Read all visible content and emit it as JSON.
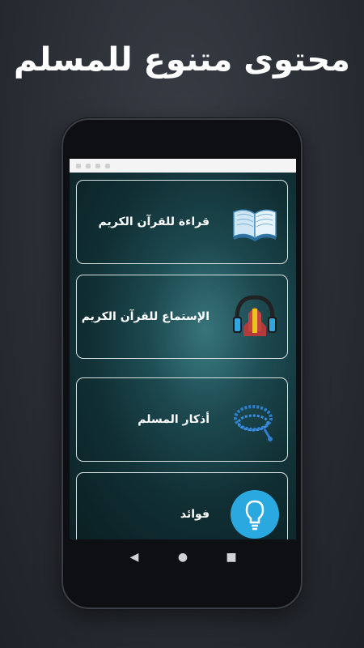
{
  "promo": {
    "title": "محتوى متنوع للمسلم"
  },
  "menu": {
    "items": [
      {
        "label": "قراءة للقرآن الكريم",
        "icon": "open-book-icon"
      },
      {
        "label": "الإستماع للقرآن الكريم",
        "icon": "headphones-quran-icon"
      },
      {
        "label": "أذكار المسلم",
        "icon": "prayer-beads-icon"
      },
      {
        "label": "فوائد",
        "icon": "lightbulb-icon"
      }
    ]
  },
  "navigation": {
    "back": "◀",
    "home": "●",
    "recents": "■"
  },
  "colors": {
    "screen_accent": "#3d7f86",
    "lightbulb_circle": "#2aa8e0"
  }
}
